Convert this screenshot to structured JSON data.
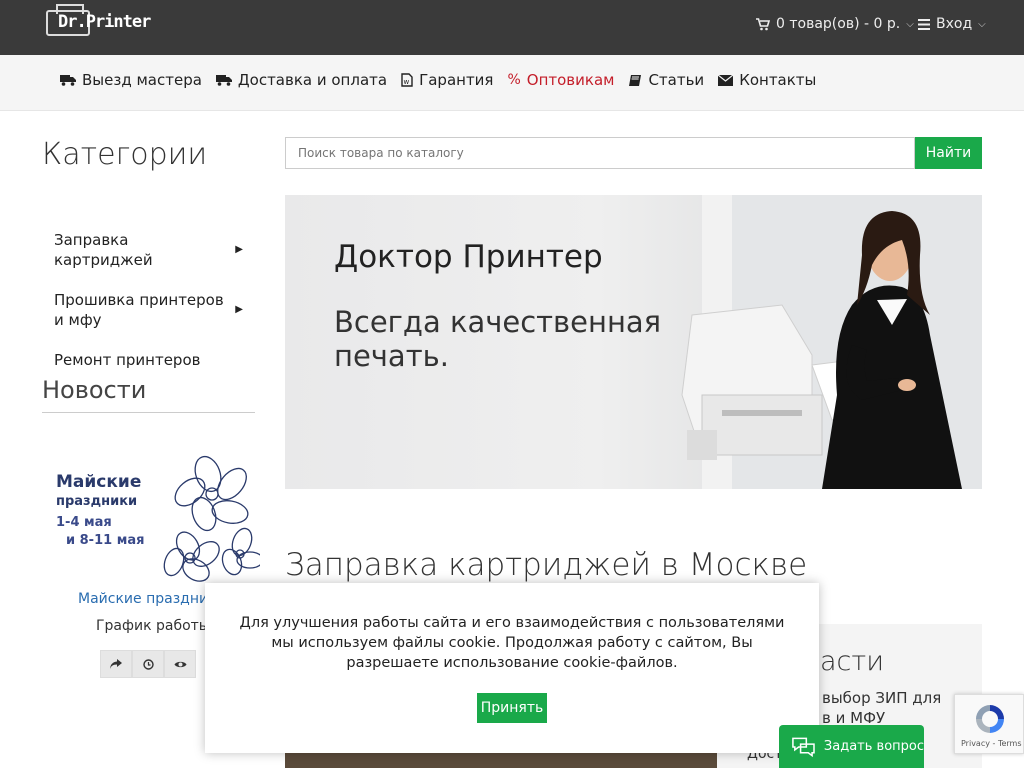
{
  "header": {
    "logo_text": "Dr.Printer",
    "cart_label": "0 товар(ов) - 0 р.",
    "login_label": "Вход"
  },
  "nav": {
    "items": [
      {
        "label": "Выезд мастера",
        "icon": "truck-icon"
      },
      {
        "label": "Доставка и оплата",
        "icon": "truck-icon"
      },
      {
        "label": "Гарантия",
        "icon": "document-icon"
      },
      {
        "label": "Оптовикам",
        "icon": "percent-icon"
      },
      {
        "label": "Статьи",
        "icon": "book-icon"
      },
      {
        "label": "Контакты",
        "icon": "envelope-icon"
      }
    ],
    "active_color": "#c41e2a"
  },
  "sidebar": {
    "title": "Категории",
    "categories": [
      {
        "label": "Заправка картриджей"
      },
      {
        "label": "Прошивка принтеров и мфу"
      },
      {
        "label": "Ремонт принтеров"
      }
    ],
    "news_title": "Новости",
    "news_image": {
      "line1": "Майские",
      "line2": "праздники",
      "line3": "1-4 мая",
      "line4": "и 8-11 мая"
    },
    "news_link": "Майские праздни",
    "news_sub": "График работы"
  },
  "search": {
    "placeholder": "Поиск товара по каталогу",
    "button_label": "Найти"
  },
  "banner": {
    "title": "Доктор Принтер",
    "subtitle": "Всегда качественная печать."
  },
  "main": {
    "heading": "Заправка картриджей в Москве"
  },
  "side_panel": {
    "title": "асти",
    "text": "выбор ЗИП для в и МФУ",
    "more": "Дост"
  },
  "cookie": {
    "text": "Для улучшения работы сайта и его взаимодействия с пользователями мы используем файлы cookie. Продолжая работу с сайтом, Вы разрешаете использование cookie-файлов.",
    "accept_label": "Принять"
  },
  "ask": {
    "label": "Задать вопрос"
  },
  "recaptcha": {
    "text": "Privacy - Terms"
  },
  "colors": {
    "accent_green": "#1aa94a",
    "topbar_bg": "#3a3a3a"
  }
}
